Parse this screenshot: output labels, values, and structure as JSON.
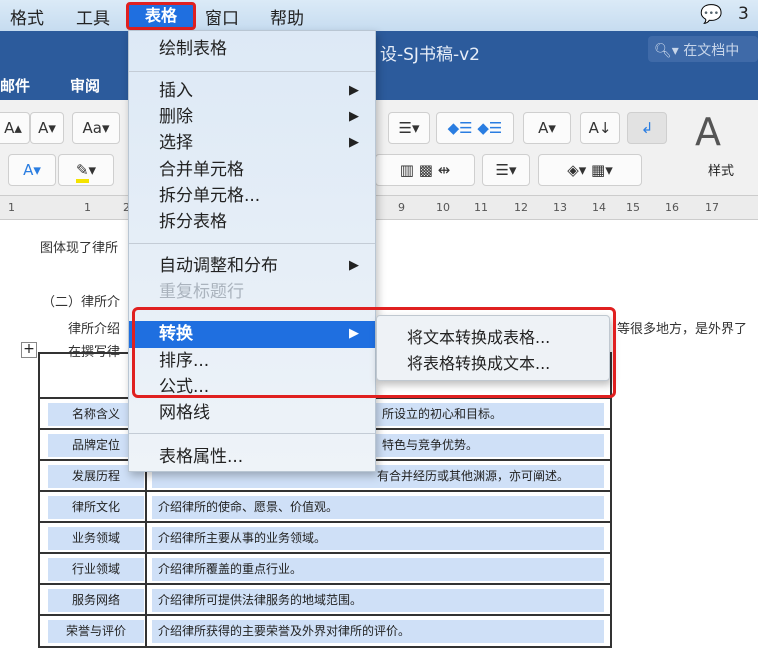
{
  "menubar": {
    "items": [
      "格式",
      "工具",
      "表格",
      "窗口",
      "帮助"
    ],
    "wechat_count": "3"
  },
  "window": {
    "title": "设-SJ书稿-v2",
    "search_placeholder": "在文档中"
  },
  "ribbon": {
    "tabs": [
      "邮件",
      "审阅"
    ],
    "styles_label": "样式"
  },
  "ruler": {
    "numbers": [
      "1",
      "1",
      "2",
      "9",
      "10",
      "11",
      "12",
      "13",
      "14",
      "15",
      "16",
      "17"
    ]
  },
  "document": {
    "heading": "（二）律所介",
    "line1": "图体现了律所",
    "line2": "律所介绍",
    "line2_right": "等很多地方，是外界了",
    "line3": "在撰写律",
    "rows": [
      {
        "label": "名称含义",
        "text": "所设立的初心和目标。"
      },
      {
        "label": "品牌定位",
        "text": "特色与竞争优势。"
      },
      {
        "label": "发展历程",
        "text": "有合并经历或其他渊源，亦可阐述。"
      },
      {
        "label": "律所文化",
        "text": "介绍律所的使命、愿景、价值观。"
      },
      {
        "label": "业务领域",
        "text": "介绍律所主要从事的业务领域。"
      },
      {
        "label": "行业领域",
        "text": "介绍律所覆盖的重点行业。"
      },
      {
        "label": "服务网络",
        "text": "介绍律所可提供法律服务的地域范围。"
      },
      {
        "label": "荣誉与评价",
        "text": "介绍律所获得的主要荣誉及外界对律所的评价。"
      }
    ]
  },
  "table_menu": {
    "items": [
      "绘制表格",
      "插入",
      "删除",
      "选择",
      "合并单元格",
      "拆分单元格...",
      "拆分表格",
      "自动调整和分布",
      "重复标题行",
      "转换",
      "排序...",
      "公式...",
      "网格线",
      "表格属性..."
    ],
    "submenu": [
      "将文本转换成表格...",
      "将表格转换成文本..."
    ]
  },
  "colors": {
    "highlight": "#1f6fe0",
    "annotation": "#e02020",
    "title_bar": "#2c5b9c"
  }
}
